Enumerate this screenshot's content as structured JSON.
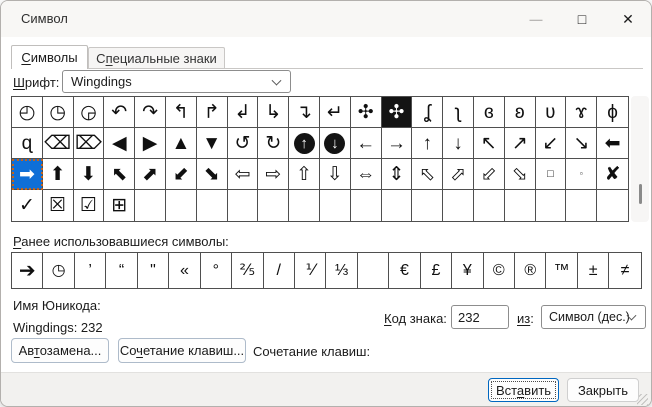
{
  "window": {
    "title": "Символ",
    "minimize_icon": "—",
    "maximize_icon": "□",
    "close_icon": "✕"
  },
  "tabs": {
    "symbols": {
      "pre": "",
      "accel": "С",
      "post": "имволы"
    },
    "special": {
      "pre": "С",
      "accel": "п",
      "post": "ециальные знаки"
    }
  },
  "font_row": {
    "label": {
      "pre": "",
      "accel": "Ш",
      "post": "рифт:"
    },
    "value": "Wingdings"
  },
  "symbol_grid": {
    "selected": {
      "row": 2,
      "col": 0
    },
    "specials": {
      "0-12": "inv-sq",
      "1-9": "inv-circ",
      "1-10": "inv-circ",
      "2-17": "sq-sm",
      "2-18": "sq-xs"
    },
    "rows": [
      [
        "◴",
        "◷",
        "◶",
        "↶",
        "↷",
        "↰",
        "↱",
        "↲",
        "↳",
        "↴",
        "↵",
        "✣",
        "✣",
        "ʆ",
        "ʅ",
        "ɞ",
        "ʚ",
        "ʋ",
        "ɤ",
        "ϕ"
      ],
      [
        "ɋ",
        "⌫",
        "⌦",
        "◀",
        "▶",
        "▲",
        "▼",
        "↺",
        "↻",
        "↑",
        "↓",
        "←",
        "→",
        "↑",
        "↓",
        "↖",
        "↗",
        "↙",
        "↘",
        "⬅"
      ],
      [
        "➡",
        "⬆",
        "⬇",
        "⬉",
        "⬈",
        "⬋",
        "⬊",
        "⇦",
        "⇨",
        "⇧",
        "⇩",
        "⇔",
        "⇕",
        "⬁",
        "⬀",
        "⬃",
        "⬂",
        "□",
        "▫",
        "✘"
      ],
      [
        "✓",
        "☒",
        "☑",
        "⊞",
        "",
        "",
        "",
        "",
        "",
        "",
        "",
        "",
        "",
        "",
        "",
        "",
        "",
        "",
        "",
        ""
      ]
    ]
  },
  "recent": {
    "label": {
      "pre": "",
      "accel": "Р",
      "post": "анее использовавшиеся символы:"
    },
    "specials": {
      "0-0": "bold-lg"
    },
    "rows": [
      [
        "➔",
        "◷",
        "’",
        "“",
        "\"",
        "«",
        "°",
        "⅖",
        "/",
        "⅟",
        "⅓",
        "",
        "€",
        "£",
        "¥",
        "©",
        "®",
        "™",
        "±",
        "≠"
      ]
    ]
  },
  "info": {
    "unicode_name_label": "Имя Юникода:",
    "unicode_name_value": "Wingdings: 232"
  },
  "code": {
    "label": {
      "pre": "",
      "accel": "К",
      "post": "од знака:"
    },
    "value": "232",
    "from_label": {
      "pre": "",
      "accel": "из",
      "post": ":"
    },
    "from_value": "Символ (дес.)"
  },
  "actions": {
    "autocorrect": {
      "pre": "Ав",
      "accel": "т",
      "post": "озамена..."
    },
    "shortcut_button": {
      "pre": "Со",
      "accel": "ч",
      "post": "етание клавиш..."
    },
    "shortcut_static": "Сочетание клавиш:"
  },
  "footer": {
    "insert": {
      "pre": "Вст",
      "accel": "а",
      "post": "вить"
    },
    "close_label": "Закрыть"
  },
  "colors": {
    "selection_blue": "#0f6fd7",
    "focus_dotted_orange": "#c4631c",
    "default_button_border": "#0067c0",
    "titlebar_bg": "#f8f7f5",
    "footer_bg": "#f2f1ef",
    "grid_line": "#4f4f4f"
  }
}
